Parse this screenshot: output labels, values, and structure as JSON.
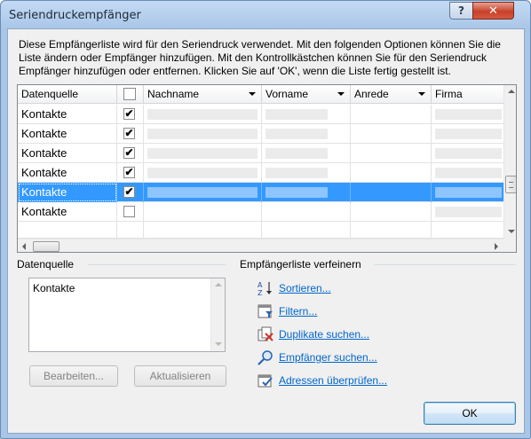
{
  "window": {
    "title": "Seriendruckempfänger",
    "help_button": "?",
    "close_button": "✕"
  },
  "description": "Diese Empfängerliste wird für den Seriendruck verwendet. Mit den folgenden Optionen können Sie die Liste ändern oder Empfänger hinzufügen. Mit den Kontrollkästchen können Sie für den Seriendruck Empfänger hinzufügen oder entfernen. Klicken Sie auf 'OK', wenn die Liste fertig gestellt ist.",
  "grid": {
    "columns": [
      "Datenquelle",
      "",
      "Nachname",
      "Vorname",
      "Anrede",
      "Firma"
    ],
    "rows": [
      {
        "source": "Kontakte",
        "checked": "✔"
      },
      {
        "source": "Kontakte",
        "checked": "✔"
      },
      {
        "source": "Kontakte",
        "checked": "✔"
      },
      {
        "source": "Kontakte",
        "checked": "✔"
      },
      {
        "source": "Kontakte",
        "checked": "✔"
      },
      {
        "source": "Kontakte",
        "checked": ""
      }
    ],
    "selected_row": 4
  },
  "datasource": {
    "label": "Datenquelle",
    "items": [
      "Kontakte"
    ],
    "edit_button": "Bearbeiten...",
    "refresh_button": "Aktualisieren"
  },
  "refine": {
    "label": "Empfängerliste verfeinern",
    "links": [
      {
        "label": "Sortieren...",
        "icon": "sort-az-icon"
      },
      {
        "label": "Filtern...",
        "icon": "filter-icon"
      },
      {
        "label": "Duplikate suchen...",
        "icon": "duplicates-icon"
      },
      {
        "label": "Empfänger suchen...",
        "icon": "find-recipient-icon"
      },
      {
        "label": "Adressen überprüfen...",
        "icon": "validate-addresses-icon"
      }
    ]
  },
  "ok_button": "OK"
}
